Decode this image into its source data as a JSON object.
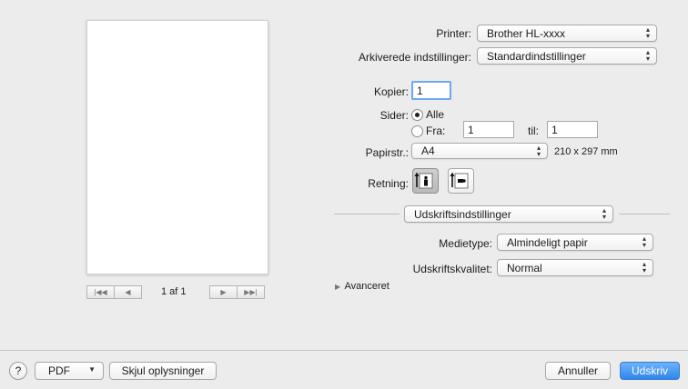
{
  "printer": {
    "label": "Printer:",
    "value": "Brother HL-xxxx"
  },
  "presets": {
    "label": "Arkiverede indstillinger:",
    "value": "Standardindstillinger"
  },
  "copies": {
    "label": "Kopier:",
    "value": "1"
  },
  "pages": {
    "label": "Sider:",
    "all_label": "Alle",
    "from_label": "Fra:",
    "from_value": "1",
    "to_label": "til:",
    "to_value": "1",
    "selected": "all"
  },
  "paper": {
    "label": "Papirstr.:",
    "value": "A4",
    "dimensions": "210 x 297 mm"
  },
  "orientation": {
    "label": "Retning:",
    "selected": "portrait"
  },
  "section_menu": {
    "value": "Udskriftsindstillinger"
  },
  "media_type": {
    "label": "Medietype:",
    "value": "Almindeligt papir"
  },
  "quality": {
    "label": "Udskriftskvalitet:",
    "value": "Normal"
  },
  "advanced": {
    "label": "Avanceret"
  },
  "preview": {
    "page_counter": "1 af 1"
  },
  "footer": {
    "help": "?",
    "pdf": "PDF",
    "details": "Skjul oplysninger",
    "cancel": "Annuller",
    "print": "Udskriv"
  },
  "colors": {
    "accent": "#4a90e8",
    "background": "#ececec"
  }
}
